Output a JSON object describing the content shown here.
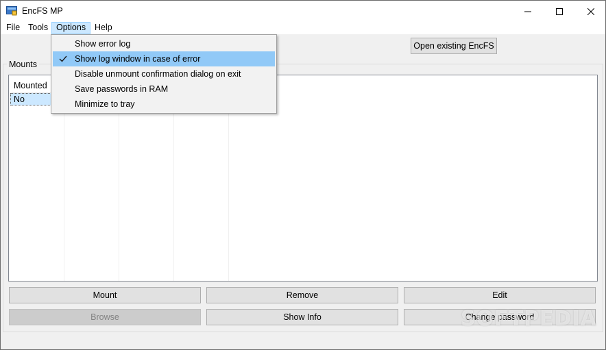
{
  "window": {
    "title": "EncFS MP"
  },
  "menubar": {
    "items": [
      "File",
      "Tools",
      "Options",
      "Help"
    ]
  },
  "toolbar": {
    "open_existing_label": "Open existing EncFS"
  },
  "mounts": {
    "group_label": "Mounts",
    "columns": [
      "Mounted"
    ],
    "rows": [
      [
        "No"
      ]
    ]
  },
  "options_menu": {
    "items": [
      {
        "label": "Show error log",
        "checked": false
      },
      {
        "label": "Show log window in case of error",
        "checked": true
      },
      {
        "label": "Disable unmount confirmation dialog on exit",
        "checked": false
      },
      {
        "label": "Save passwords in RAM",
        "checked": false
      },
      {
        "label": "Minimize to tray",
        "checked": false
      }
    ]
  },
  "actions": {
    "mount_label": "Mount",
    "remove_label": "Remove",
    "edit_label": "Edit",
    "browse_label": "Browse",
    "show_info_label": "Show Info",
    "change_password_label": "Change password"
  },
  "watermark": "SOFTPEDIA",
  "colors": {
    "menu_active": "#cce8ff",
    "menu_hover": "#91c9f7",
    "selection": "#cce8ff",
    "button_face": "#e1e1e1"
  }
}
